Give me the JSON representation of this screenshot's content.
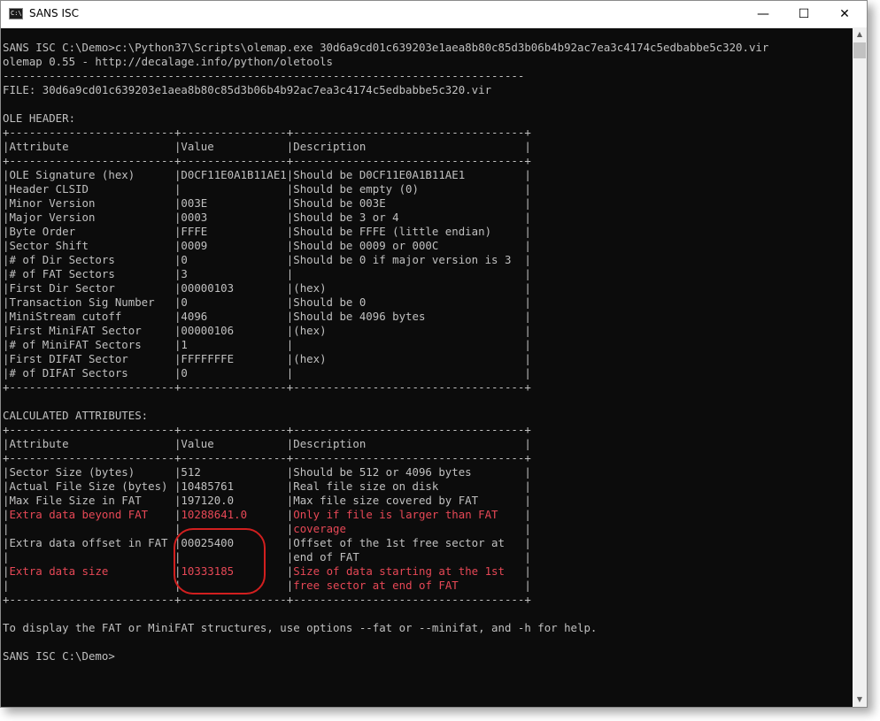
{
  "window": {
    "title": "SANS ISC",
    "icon": "console-icon",
    "icon_text": "C:\\",
    "minimize": "—",
    "maximize": "☐",
    "close": "✕"
  },
  "terminal": {
    "lines": [
      {
        "text": "SANS ISC C:\\Demo>c:\\Python37\\Scripts\\olemap.exe 30d6a9cd01c639203e1aea8b80c85d3b06b4b92ac7ea3c4174c5edbabbe5c320.vir"
      },
      {
        "text": "olemap 0.55 - http://decalage.info/python/oletools"
      },
      {
        "text": "-------------------------------------------------------------------------------"
      },
      {
        "text": "FILE: 30d6a9cd01c639203e1aea8b80c85d3b06b4b92ac7ea3c4174c5edbabbe5c320.vir"
      },
      {
        "text": ""
      },
      {
        "text": "OLE HEADER:"
      },
      {
        "text": "+-------------------------+----------------+-----------------------------------+"
      },
      {
        "text": "|Attribute                |Value           |Description                        |"
      },
      {
        "text": "+-------------------------+----------------+-----------------------------------+"
      },
      {
        "text": "|OLE Signature (hex)      |D0CF11E0A1B11AE1|Should be D0CF11E0A1B11AE1         |"
      },
      {
        "text": "|Header CLSID             |                |Should be empty (0)                |"
      },
      {
        "text": "|Minor Version            |003E            |Should be 003E                     |"
      },
      {
        "text": "|Major Version            |0003            |Should be 3 or 4                   |"
      },
      {
        "text": "|Byte Order               |FFFE            |Should be FFFE (little endian)     |"
      },
      {
        "text": "|Sector Shift             |0009            |Should be 0009 or 000C             |"
      },
      {
        "text": "|# of Dir Sectors         |0               |Should be 0 if major version is 3  |"
      },
      {
        "text": "|# of FAT Sectors         |3               |                                   |"
      },
      {
        "text": "|First Dir Sector         |00000103        |(hex)                              |"
      },
      {
        "text": "|Transaction Sig Number   |0               |Should be 0                        |"
      },
      {
        "text": "|MiniStream cutoff        |4096            |Should be 4096 bytes               |"
      },
      {
        "text": "|First MiniFAT Sector     |00000106        |(hex)                              |"
      },
      {
        "text": "|# of MiniFAT Sectors     |1               |                                   |"
      },
      {
        "text": "|First DIFAT Sector       |FFFFFFFE        |(hex)                              |"
      },
      {
        "text": "|# of DIFAT Sectors       |0               |                                   |"
      },
      {
        "text": "+-------------------------+----------------+-----------------------------------+"
      },
      {
        "text": ""
      },
      {
        "text": "CALCULATED ATTRIBUTES:"
      },
      {
        "text": "+-------------------------+----------------+-----------------------------------+"
      },
      {
        "text": "|Attribute                |Value           |Description                        |"
      },
      {
        "text": "+-------------------------+----------------+-----------------------------------+"
      },
      {
        "text": "|Sector Size (bytes)      |512             |Should be 512 or 4096 bytes        |"
      },
      {
        "text": "|Actual File Size (bytes) |10485761        |Real file size on disk             |"
      },
      {
        "text": "|Max File Size in FAT     |197120.0        |Max file size covered by FAT       |"
      },
      {
        "text": "|",
        "red": "Extra data beyond FAT    ",
        "mid": "|",
        "red2": "10288641.0      ",
        "mid2": "|",
        "red3": "Only if file is larger than FAT    ",
        "end": "|"
      },
      {
        "text": "|",
        "red": "                         ",
        "mid": "|",
        "red2": "                ",
        "mid2": "|",
        "red3": "coverage                           ",
        "end": "|"
      },
      {
        "text": "|Extra data offset in FAT |00025400        |Offset of the 1st free sector at   |"
      },
      {
        "text": "|                         |                |end of FAT                         |"
      },
      {
        "text": "|",
        "red": "Extra data size          ",
        "mid": "|",
        "red2": "10333185        ",
        "mid2": "|",
        "red3": "Size of data starting at the 1st   ",
        "end": "|"
      },
      {
        "text": "|",
        "red": "                         ",
        "mid": "|",
        "red2": "                ",
        "mid2": "|",
        "red3": "free sector at end of FAT          ",
        "end": "|"
      },
      {
        "text": "+-------------------------+----------------+-----------------------------------+"
      },
      {
        "text": ""
      },
      {
        "text": "To display the FAT or MiniFAT structures, use options --fat or --minifat, and -h for help."
      },
      {
        "text": ""
      },
      {
        "text": "SANS ISC C:\\Demo>"
      }
    ]
  },
  "colors": {
    "background": "#0c0c0c",
    "text": "#c0c0c0",
    "highlight_text": "#e74856",
    "annotation": "#d21f1f"
  }
}
